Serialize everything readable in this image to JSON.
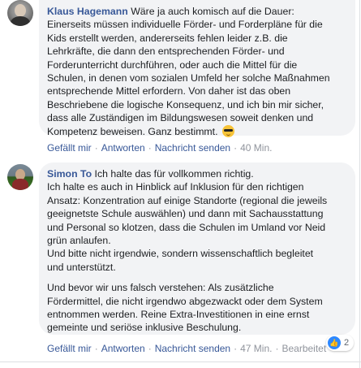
{
  "comment1": {
    "author": "Klaus Hagemann",
    "lines": [
      "Wäre ja auch komisch auf die Dauer:",
      "Einerseits müssen individuelle Förder- und Forderpläne für die",
      "Kids erstellt werden, andererseits fehlen leider z.B. die",
      "Lehrkräfte, die dann den entsprechenden Förder- und",
      "Forderunterricht durchführen, oder auch die Mittel für die",
      "Schulen, in denen vom sozialen Umfeld her solche Maßnahmen",
      "entsprechende Mittel erfordern. Von daher ist das oben",
      "Beschriebene die logische Konsequenz, und ich bin mir sicher,",
      "dass alle Zuständigen im Bildungswesen soweit denken und",
      "Kompetenz beweisen. Ganz bestimmt."
    ],
    "emoji": "sunglasses-emoji",
    "actions": {
      "like": "Gefällt mir",
      "reply": "Antworten",
      "message": "Nachricht senden",
      "time": "40 Min."
    }
  },
  "comment2": {
    "author": "Simon To",
    "first_line": "Ich halte das für vollkommen richtig.",
    "para1": [
      "Ich halte es auch in Hinblick auf Inklusion für den richtigen",
      "Ansatz: Konzentration auf einige Standorte (regional die jeweils",
      "geeignetste Schule auswählen) und dann mit Sachausstattung",
      "und Personal so klotzen, dass die Schulen im Umland vor Neid",
      "grün anlaufen.",
      "Und bitte nicht irgendwie, sondern wissenschaftlich begleitet",
      "und unterstützt."
    ],
    "para2": [
      "Und bevor wir uns falsch verstehen: Als zusätzliche",
      "Fördermittel, die nicht irgendwo abgezwackt oder dem System",
      "entnommen werden. Reine Extra-Investitionen in eine ernst",
      "gemeinte und seriöse inklusive Beschulung."
    ],
    "reaction": {
      "icon": "like-icon",
      "count": "2"
    },
    "actions": {
      "like": "Gefällt mir",
      "reply": "Antworten",
      "message": "Nachricht senden",
      "time": "47 Min.",
      "edit": "Bearbeitet"
    }
  },
  "colors": {
    "author": "#385898",
    "bubble": "#f2f3f5",
    "meta": "#90949c"
  }
}
